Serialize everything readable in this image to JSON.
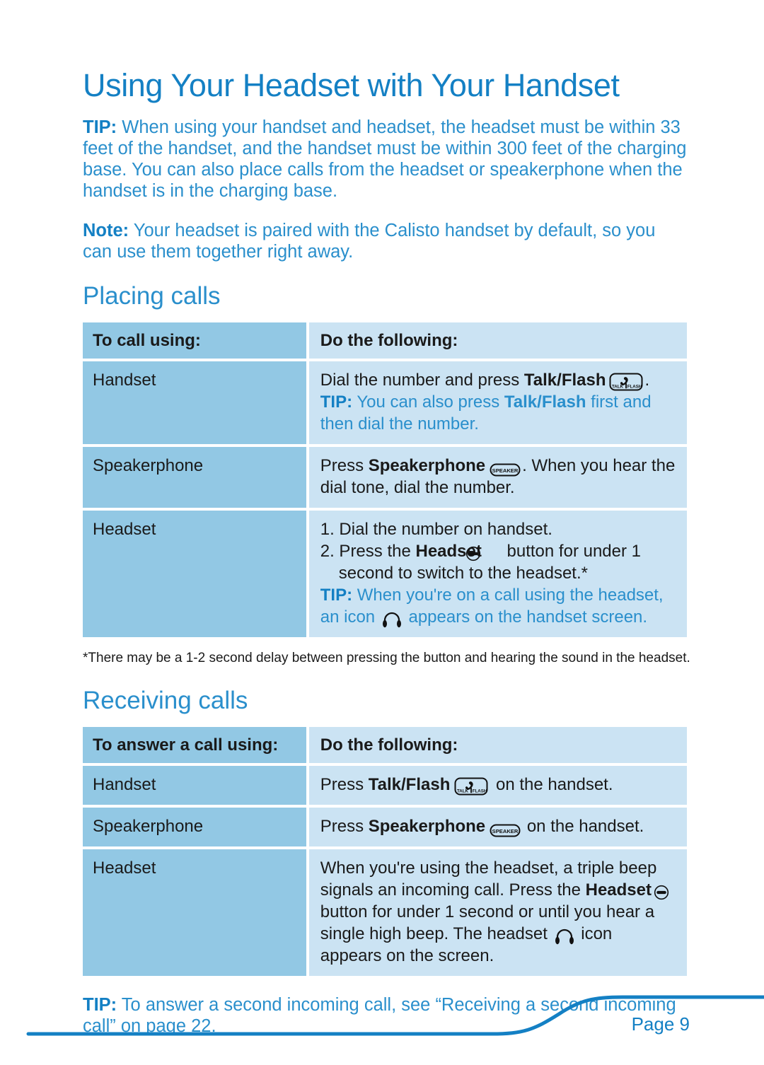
{
  "document": {
    "title": "Using Your Headset with Your Handset",
    "accent_color": "#1480C4",
    "body_text_color": "#2A8FCC",
    "table_left_color": "#92C8E4",
    "table_right_color": "#CBE3F3"
  },
  "intro": {
    "tip_label": "TIP:",
    "tip_text": " When using your handset and headset, the headset must be within 33 feet of the handset, and the handset must be within 300 feet of the charging base. You can also place calls from the headset or speakerphone when the handset is in the charging base.",
    "note_label": "Note:",
    "note_text": " Your headset is paired with the Calisto handset by default, so you can use them together right away."
  },
  "placing_calls": {
    "heading": "Placing calls",
    "columns": [
      "To call using:",
      "Do the following:"
    ],
    "rows": [
      {
        "label": "Handset",
        "main_pre": "Dial the number and press ",
        "main_bold": "Talk/Flash",
        "main_post": ".",
        "tip_label": "TIP:",
        "tip_pre": " You can also press ",
        "tip_bold": "Talk/Flash",
        "tip_post": " first and then dial the number."
      },
      {
        "label": "Speakerphone",
        "main_pre": "Press ",
        "main_bold": "Speakerphone",
        "main_post": ". When you hear the dial tone, dial the number."
      },
      {
        "label": "Headset",
        "step1": "1.  Dial the number on handset.",
        "step2_pre": "2.  Press the ",
        "step2_bold": "Headset",
        "step2_post": " button for under 1 second to switch to the headset.*",
        "tip_label": "TIP:",
        "tip_pre": " When you're on a call using the headset, an icon ",
        "tip_post": " appears on the handset screen."
      }
    ],
    "footnote": "*There may be a 1-2 second delay between pressing the button and hearing the sound in the headset."
  },
  "receiving_calls": {
    "heading": "Receiving calls",
    "columns": [
      "To answer a call using:",
      "Do the following:"
    ],
    "rows": [
      {
        "label": "Handset",
        "main_pre": "Press ",
        "main_bold": "Talk/Flash",
        "main_post": " on the handset."
      },
      {
        "label": "Speakerphone",
        "main_pre": "Press ",
        "main_bold": "Speakerphone",
        "main_post": " on the handset."
      },
      {
        "label": "Headset",
        "part1": "When you're using the headset, a triple beep signals an incoming call. Press the ",
        "part1_bold": "Headset",
        "part2": " button for under 1 second or until you hear a single high beep. The headset ",
        "part3": " icon appears on the screen."
      }
    ]
  },
  "bottom_tip": {
    "label": "TIP:",
    "text": " To answer a second incoming call, see “Receiving a second incoming call” on page 22."
  },
  "footer": {
    "page_label": "Page 9"
  },
  "icons": {
    "talk_flash": "talk-flash-button-icon",
    "speaker": "speaker-button-icon",
    "headset_button": "headset-button-icon",
    "headphone": "headphone-icon"
  }
}
